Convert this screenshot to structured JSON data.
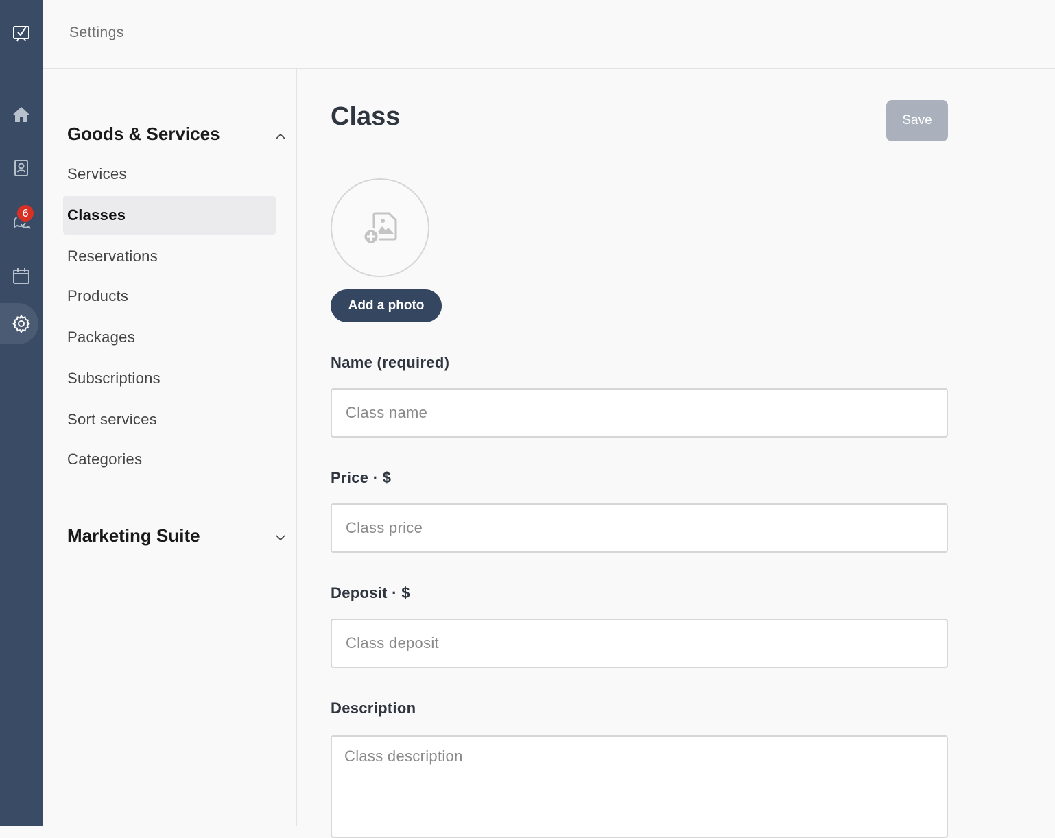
{
  "rail": {
    "items": [
      {
        "icon": "checkbox-board-icon"
      },
      {
        "icon": "home-icon"
      },
      {
        "icon": "contacts-icon"
      },
      {
        "icon": "chat-icon",
        "badge": "6"
      },
      {
        "icon": "calendar-icon"
      },
      {
        "icon": "gear-icon",
        "active": true
      }
    ],
    "colors": {
      "background": "#3a4b66",
      "badge": "#d93025"
    }
  },
  "header": {
    "title": "Settings"
  },
  "subnav": {
    "groups": [
      {
        "title": "Goods & Services",
        "expanded": true,
        "items": [
          "Services",
          "Classes",
          "Reservations",
          "Products",
          "Packages",
          "Subscriptions",
          "Sort services",
          "Categories"
        ],
        "selected": "Classes"
      },
      {
        "title": "Marketing Suite",
        "expanded": false
      }
    ]
  },
  "form": {
    "title": "Class",
    "save_label": "Save",
    "add_photo_label": "Add a photo",
    "name": {
      "label": "Name (required)",
      "placeholder": "Class name",
      "value": ""
    },
    "price": {
      "label": "Price · $",
      "placeholder": "Class price",
      "value": ""
    },
    "deposit": {
      "label": "Deposit · $",
      "placeholder": "Class deposit",
      "value": ""
    },
    "description": {
      "label": "Description",
      "placeholder": "Class description",
      "value": ""
    },
    "colors": {
      "primary_button": "#344660",
      "disabled_button": "#aab1bd"
    }
  }
}
